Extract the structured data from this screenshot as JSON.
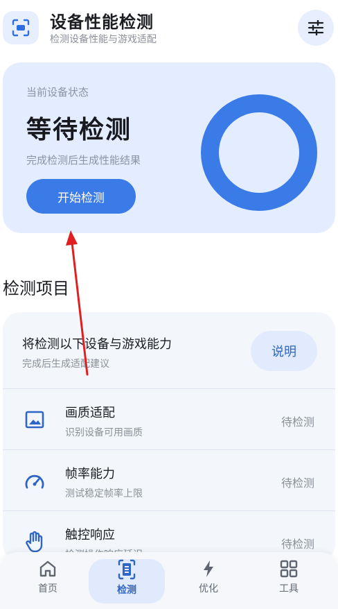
{
  "header": {
    "title": "设备性能检测",
    "subtitle": "检测设备性能与游戏适配",
    "app_icon": "scan-icon",
    "action_icon": "sliders-icon"
  },
  "status_card": {
    "label": "当前设备状态",
    "value": "等待检测",
    "hint": "完成检测后生成性能结果",
    "start_button": "开始检测",
    "ring_color": "#3a7be8"
  },
  "section": {
    "title": "检测项目"
  },
  "list": {
    "head_title": "将检测以下设备与游戏能力",
    "head_sub": "完成后生成适配建议",
    "explain_button": "说明",
    "items": [
      {
        "icon": "image-icon",
        "name": "画质适配",
        "desc": "识别设备可用画质",
        "status": "待检测"
      },
      {
        "icon": "gauge-icon",
        "name": "帧率能力",
        "desc": "测试稳定帧率上限",
        "status": "待检测"
      },
      {
        "icon": "hand-icon",
        "name": "触控响应",
        "desc": "检测操作响应延迟",
        "status": "待检测"
      }
    ]
  },
  "nav": {
    "items": [
      {
        "icon": "home-icon",
        "label": "首页"
      },
      {
        "icon": "scan-doc-icon",
        "label": "检测"
      },
      {
        "icon": "bolt-icon",
        "label": "优化"
      },
      {
        "icon": "grid-icon",
        "label": "工具"
      }
    ],
    "active": "检测"
  },
  "colors": {
    "accent": "#3a7be8",
    "card_bg": "#e3edff",
    "annotation": "#e02020"
  }
}
